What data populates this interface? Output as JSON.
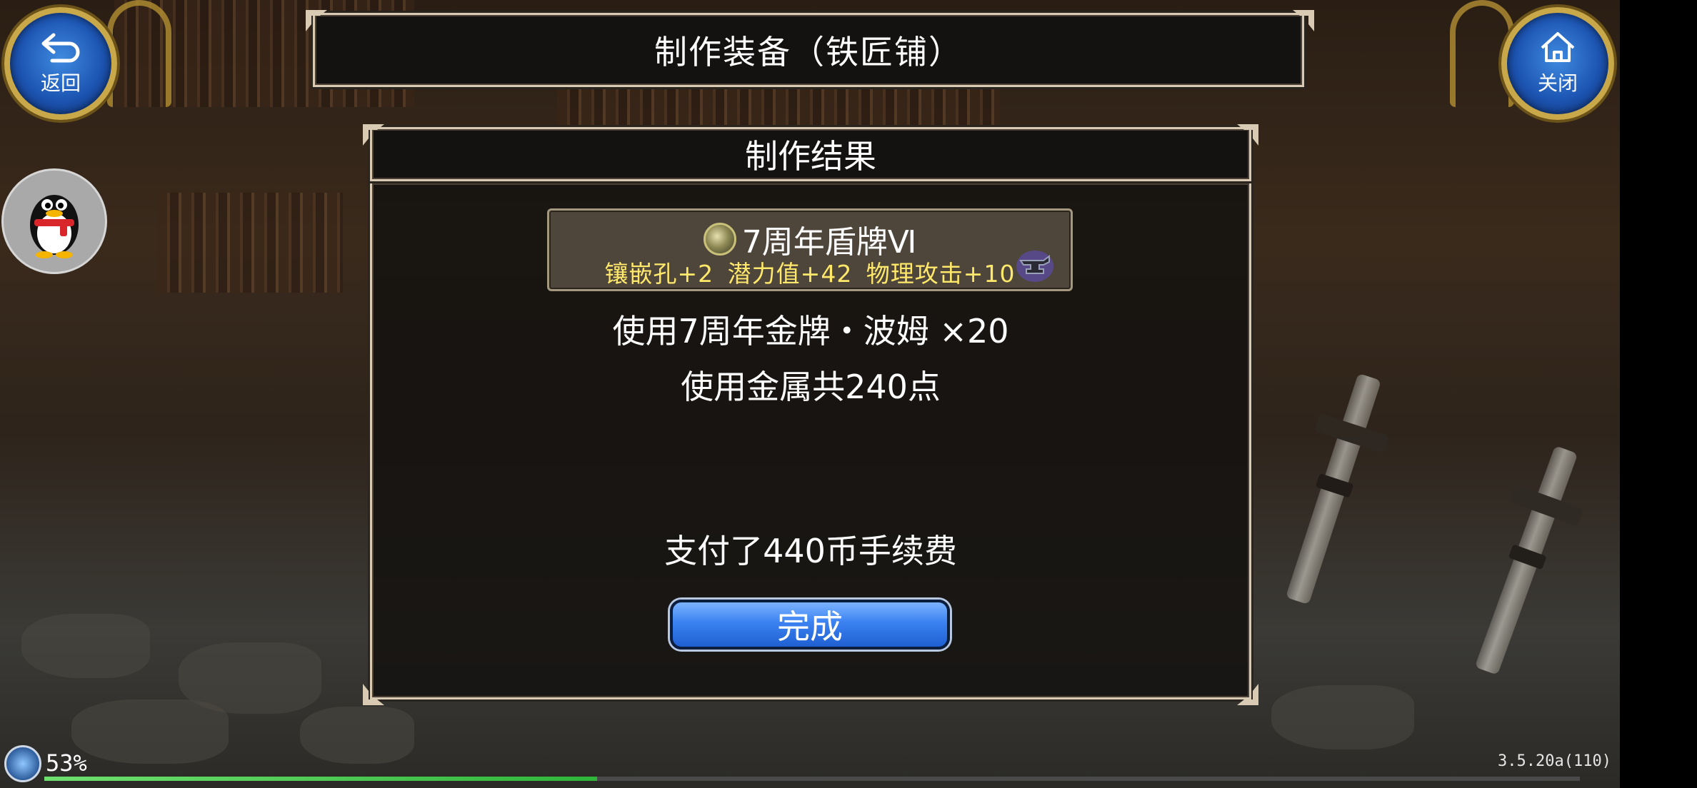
{
  "header": {
    "title": "制作装备（铁匠铺）"
  },
  "nav": {
    "back_label": "返回",
    "close_label": "关闭"
  },
  "panel": {
    "title": "制作结果",
    "item": {
      "name": "7周年盾牌Ⅵ",
      "stats": "镶嵌孔+2  潜力值+42  物理攻击+10"
    },
    "material_line": "使用7周年金牌・波姆 ×20",
    "metal_line": "使用金属共240点",
    "fee_line": "支付了440币手续费",
    "done_label": "完成"
  },
  "status": {
    "battery": "53%",
    "load_progress": 0.36,
    "version": "3.5.20a(110)"
  },
  "colors": {
    "stat_text": "#ffe86a",
    "done_button": "#3b82f1",
    "round_button": "#1d55b3",
    "progress": "#2fb53a"
  },
  "icons": {
    "back": "back-arrow-icon",
    "close": "home-icon",
    "qq": "qq-penguin-icon",
    "item": "shield-icon",
    "anvil": "anvil-icon",
    "battery": "battery-orb-icon"
  }
}
